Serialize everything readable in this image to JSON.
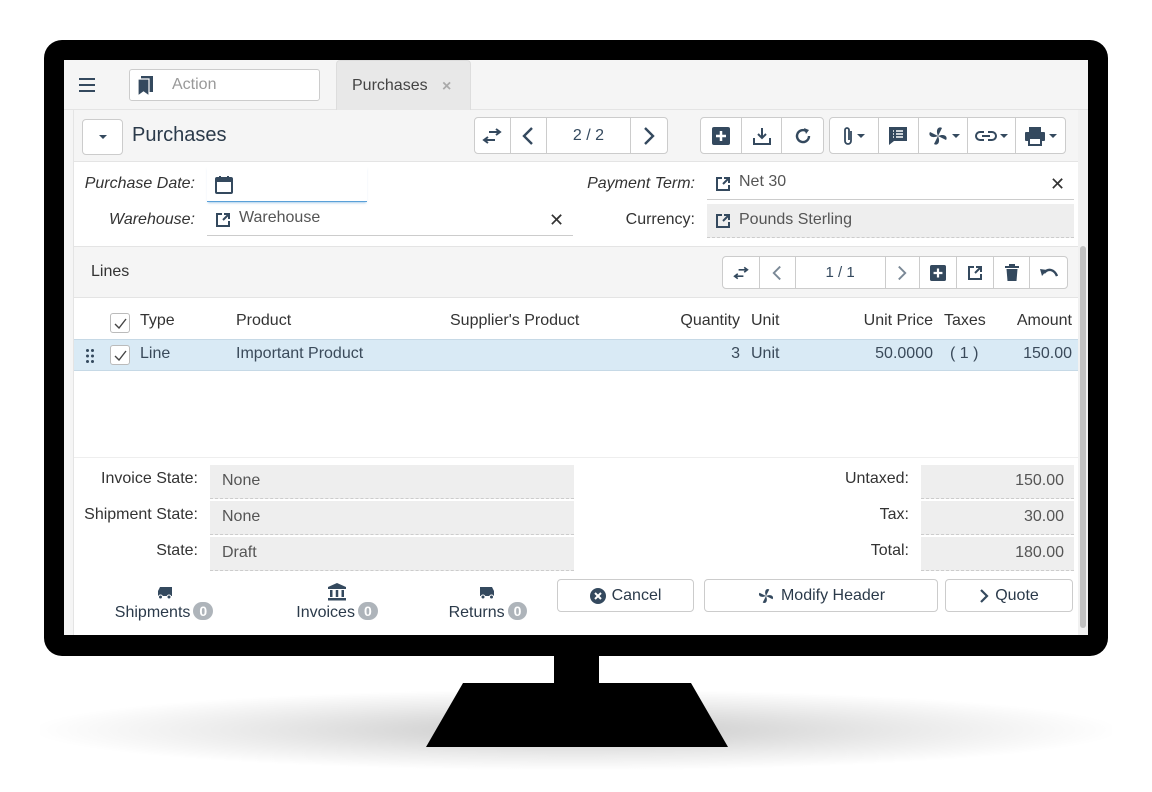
{
  "topbar": {
    "menu_icon": "hamburger-menu-icon",
    "action_placeholder": "Action",
    "action_icon": "bookmark-icon",
    "tab_label": "Purchases",
    "tab_close": "×"
  },
  "header": {
    "title": "Purchases",
    "record_position": "2 / 2",
    "toolbar_icons": [
      "switch-view-icon",
      "previous-icon",
      "next-icon",
      "new-record-icon",
      "save-icon",
      "reload-icon",
      "attachment-icon",
      "note-icon",
      "action-icon",
      "relate-icon",
      "print-icon"
    ]
  },
  "form": {
    "purchase_date_label": "Purchase Date:",
    "purchase_date_value": "",
    "warehouse_label": "Warehouse:",
    "warehouse_value": "Warehouse",
    "payment_term_label": "Payment Term:",
    "payment_term_value": "Net 30",
    "currency_label": "Currency:",
    "currency_value": "Pounds Sterling",
    "clear_symbol": "✕"
  },
  "lines": {
    "title": "Lines",
    "record_position": "1 / 1",
    "columns": [
      "Type",
      "Product",
      "Supplier's Product",
      "Quantity",
      "Unit",
      "Unit Price",
      "Taxes",
      "Amount"
    ],
    "rows": [
      {
        "selected": true,
        "type": "Line",
        "product": "Important Product",
        "supplier_product": "",
        "quantity": "3",
        "unit": "Unit",
        "unit_price": "50.0000",
        "taxes": "( 1 )",
        "amount": "150.00"
      }
    ]
  },
  "summary": {
    "invoice_state_label": "Invoice State:",
    "invoice_state_value": "None",
    "shipment_state_label": "Shipment State:",
    "shipment_state_value": "None",
    "state_label": "State:",
    "state_value": "Draft",
    "untaxed_label": "Untaxed:",
    "untaxed_value": "150.00",
    "tax_label": "Tax:",
    "tax_value": "30.00",
    "total_label": "Total:",
    "total_value": "180.00"
  },
  "related": [
    {
      "label": "Shipments",
      "count": "0",
      "icon": "truck-icon"
    },
    {
      "label": "Invoices",
      "count": "0",
      "icon": "bank-icon"
    },
    {
      "label": "Returns",
      "count": "0",
      "icon": "truck-return-icon"
    }
  ],
  "buttons": {
    "cancel": "Cancel",
    "modify_header": "Modify Header",
    "quote": "Quote"
  },
  "colors": {
    "accent": "#34495e",
    "selected_row": "#d9eaf5",
    "readonly_field": "#eeeeee",
    "badge": "#aeb4ba"
  }
}
